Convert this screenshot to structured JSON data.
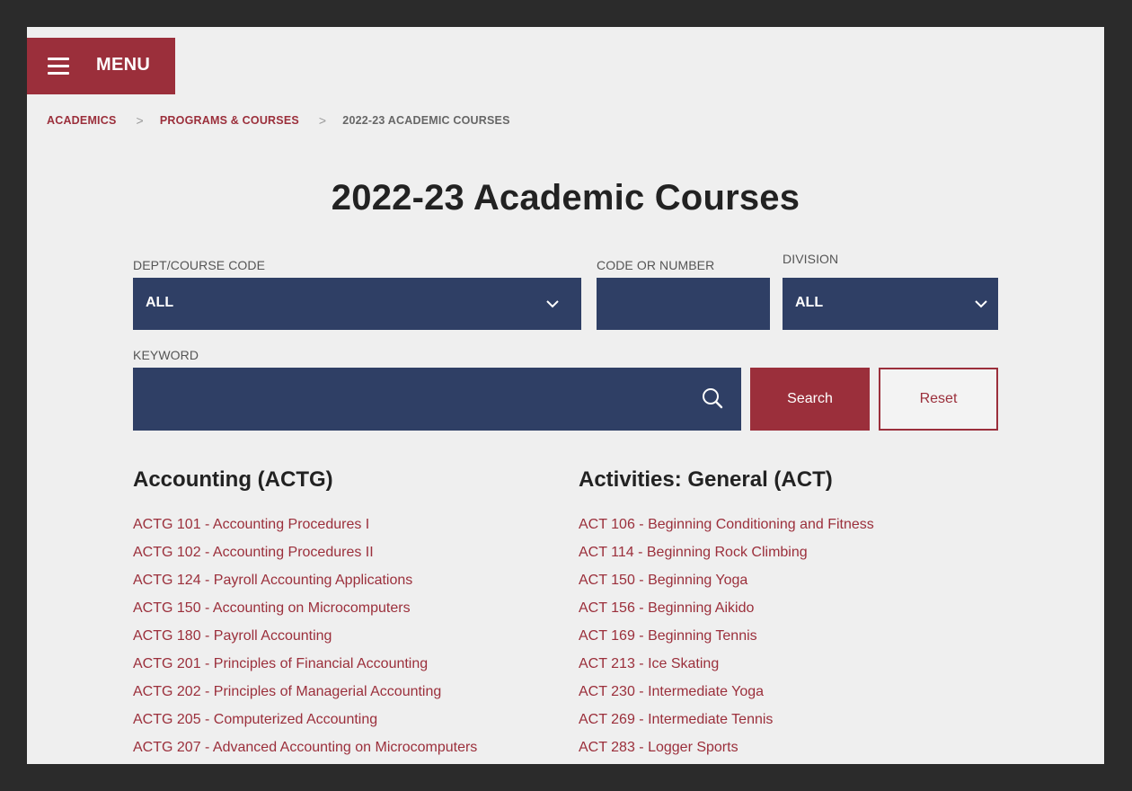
{
  "menu": {
    "label": "MENU"
  },
  "breadcrumb": [
    {
      "label": "ACADEMICS"
    },
    {
      "label": "PROGRAMS & COURSES"
    },
    {
      "label": "2022-23 ACADEMIC COURSES"
    }
  ],
  "page_title": "2022-23 Academic Courses",
  "filters": {
    "dept": {
      "label": "DEPT/COURSE CODE",
      "value": "ALL"
    },
    "code": {
      "label": "CODE OR NUMBER",
      "value": ""
    },
    "division": {
      "label": "DIVISION",
      "value": "ALL"
    },
    "keyword": {
      "label": "KEYWORD",
      "value": ""
    }
  },
  "buttons": {
    "search": "Search",
    "reset": "Reset"
  },
  "colors": {
    "accent": "#9b2f3b",
    "navy": "#2f3f65",
    "background": "#efefef"
  },
  "sections": [
    {
      "title": "Accounting (ACTG)",
      "courses": [
        "ACTG 101 - Accounting Procedures I",
        "ACTG 102 - Accounting Procedures II",
        "ACTG 124 - Payroll Accounting Applications",
        "ACTG 150 - Accounting on Microcomputers",
        "ACTG 180 - Payroll Accounting",
        "ACTG 201 - Principles of Financial Accounting",
        "ACTG 202 - Principles of Managerial Accounting",
        "ACTG 205 - Computerized Accounting",
        "ACTG 207 - Advanced Accounting on Microcomputers"
      ]
    },
    {
      "title": "Activities: General (ACT)",
      "courses": [
        "ACT 106 - Beginning Conditioning and Fitness",
        "ACT 114 - Beginning Rock Climbing",
        "ACT 150 - Beginning Yoga",
        "ACT 156 - Beginning Aikido",
        "ACT 169 - Beginning Tennis",
        "ACT 213 - Ice Skating",
        "ACT 230 - Intermediate Yoga",
        "ACT 269 - Intermediate Tennis",
        "ACT 283 - Logger Sports"
      ]
    }
  ]
}
